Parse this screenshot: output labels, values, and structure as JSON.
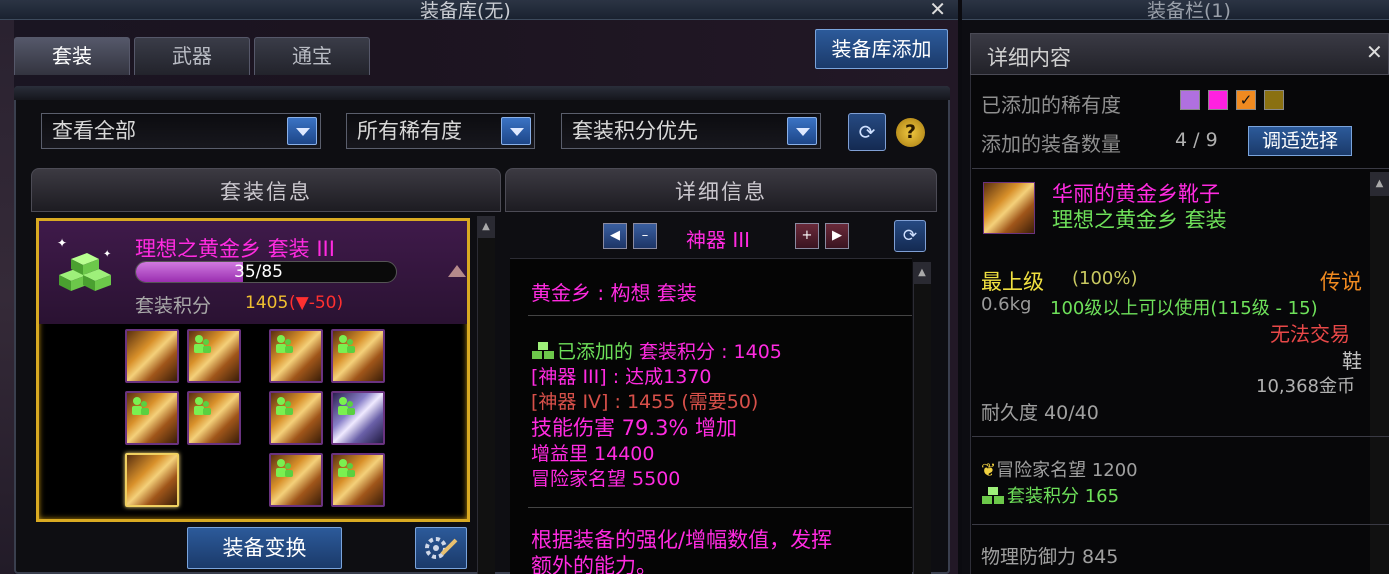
{
  "window": {
    "title": "装备库(无)",
    "right_window_title": "装备栏(1)"
  },
  "tabs": [
    {
      "label": "套装",
      "active": true
    },
    {
      "label": "武器",
      "active": false
    },
    {
      "label": "通宝",
      "active": false
    }
  ],
  "add_button": "装备库添加",
  "filters": {
    "view": "查看全部",
    "rarity": "所有稀有度",
    "sort": "套装积分优先"
  },
  "section_titles": {
    "set_info": "套装信息",
    "detail_info": "详细信息"
  },
  "set_card": {
    "name": "理想之黄金乡  套装 III",
    "progress_text": "35/85",
    "progress_fraction": 0.4118,
    "score_label": "套装积分",
    "score_value": "1405",
    "score_delta": "(▼-50)"
  },
  "set_slots": [
    {
      "type": "gold",
      "owned": false,
      "highlight": false
    },
    {
      "type": "gold",
      "owned": true,
      "highlight": false
    },
    {
      "type": "gold",
      "owned": true,
      "highlight": false
    },
    {
      "type": "gold",
      "owned": true,
      "highlight": false
    },
    {
      "type": "gold",
      "owned": true,
      "highlight": false
    },
    {
      "type": "gold",
      "owned": true,
      "highlight": false
    },
    {
      "type": "gold",
      "owned": true,
      "highlight": false
    },
    {
      "type": "purple",
      "owned": true,
      "highlight": false
    },
    {
      "type": "gold",
      "owned": false,
      "highlight": true
    },
    {
      "type": "gold",
      "owned": true,
      "highlight": false
    },
    {
      "type": "gold",
      "owned": true,
      "highlight": false
    }
  ],
  "switch_button": "装备变换",
  "detail": {
    "tier": "神器 III",
    "set_title": "黄金乡 : 构想  套装",
    "added_prefix": "已添加的",
    "score_text": " 套装积分 : 1405",
    "tier3_text": "[神器 III] : 达成1370",
    "tier4_text": "[神器 IV] : 1455 (需要50)",
    "skill_damage": "技能伤害 79.3% 增加",
    "buff": "增益里 14400",
    "fame": "冒险家名望 5500",
    "desc_line1": "根据装备的强化/增幅数值，发挥",
    "desc_line2": "额外的能力。"
  },
  "right_panel": {
    "title": "详细内容",
    "rarity_label": "已添加的稀有度",
    "rarity_colors": [
      "#b070e0",
      "#ff20e0",
      "#f08a20",
      "#8a7010"
    ],
    "count_label": "添加的装备数量",
    "count_value": "4 / 9",
    "adjust_button": "调适选择",
    "item_name": "华丽的黄金乡靴子",
    "item_set": "理想之黄金乡  套装",
    "grade": "最上级",
    "grade_pct": "(100%)",
    "rarity_name": "传说",
    "weight": "0.6kg",
    "level_req": "100级以上可以使用(115级 - 15)",
    "trade": "无法交易",
    "slot_type": "鞋",
    "price": "10,368金币",
    "durability": "耐久度 40/40",
    "fame": "冒险家名望 1200",
    "set_score": "套装积分 165",
    "phys_def": "物理防御力 845"
  }
}
